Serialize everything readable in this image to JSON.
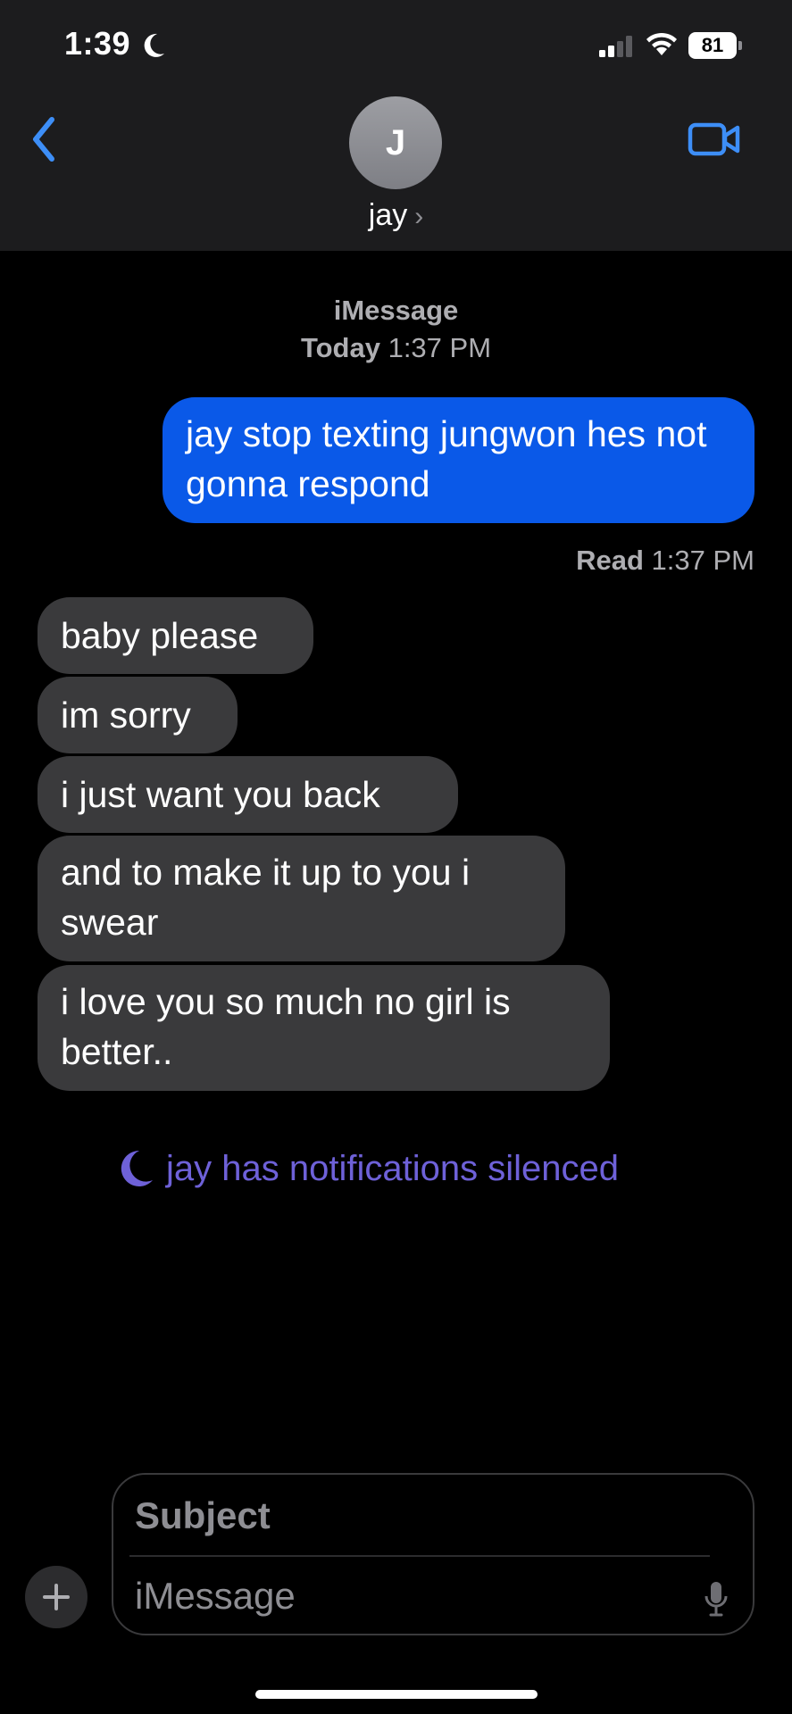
{
  "status_bar": {
    "time": "1:39",
    "battery": "81"
  },
  "contact": {
    "initial": "J",
    "name": "jay"
  },
  "thread": {
    "service": "iMessage",
    "date": "Today",
    "time": "1:37 PM"
  },
  "messages": [
    {
      "from": "me",
      "text": "jay stop texting jungwon hes not gonna respond"
    },
    {
      "from": "them",
      "text": "baby please"
    },
    {
      "from": "them",
      "text": "im sorry"
    },
    {
      "from": "them",
      "text": "i just want you back"
    },
    {
      "from": "them",
      "text": "and to make it up to you i swear"
    },
    {
      "from": "them",
      "text": "i love you so much no girl is better.."
    }
  ],
  "read_receipt": {
    "label": "Read",
    "time": "1:37 PM"
  },
  "notice": "jay has notifications silenced",
  "composer": {
    "subject_placeholder": "Subject",
    "message_placeholder": "iMessage"
  },
  "colors": {
    "sent_bubble": "#0a59e8",
    "received_bubble": "#3a3a3c",
    "accent": "#3d8ef7",
    "focus_purple": "#6e61d8"
  },
  "icons": [
    "moon-icon",
    "signal-icon",
    "wifi-icon",
    "battery-icon",
    "back-chevron-icon",
    "video-camera-icon",
    "plus-icon",
    "microphone-icon"
  ]
}
